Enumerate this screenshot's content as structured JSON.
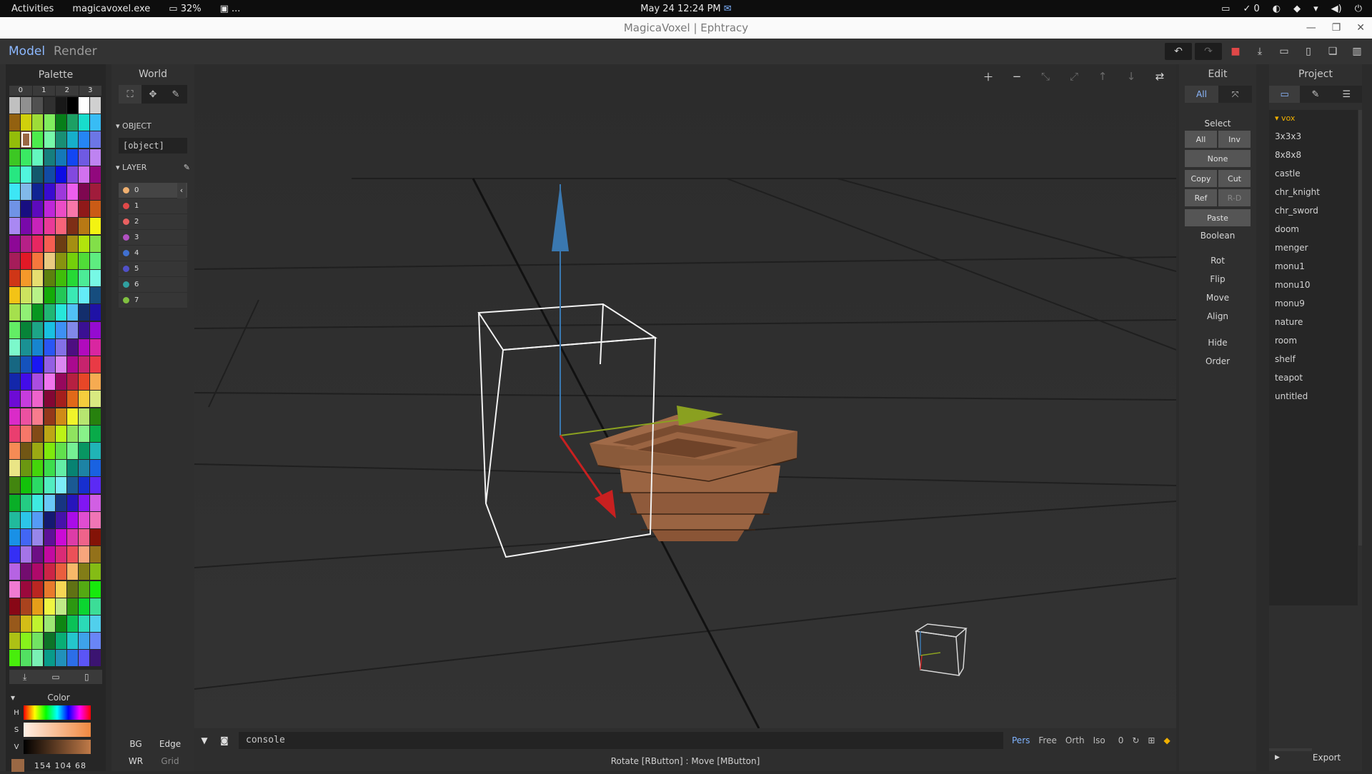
{
  "system": {
    "activities": "Activities",
    "app_name": "magicavoxel.exe",
    "battery": "32%",
    "tray_more": "...",
    "datetime": "May 24  12:24 PM",
    "check_count": "0"
  },
  "window": {
    "title": "MagicaVoxel | Ephtracy"
  },
  "appbar": {
    "mode_model": "Model",
    "mode_render": "Render",
    "project_name": "project"
  },
  "palette": {
    "title": "Palette",
    "tabs": [
      "0",
      "1",
      "2",
      "3"
    ],
    "selected_color": "#9a6844"
  },
  "color": {
    "title": "Color",
    "h": "H",
    "s": "S",
    "v": "V",
    "rgb": "154  104  68"
  },
  "world": {
    "title": "World",
    "object_label": "OBJECT",
    "object_value": "[object]",
    "layer_label": "LAYER",
    "layers": [
      {
        "name": "0",
        "color": "#f0b070"
      },
      {
        "name": "1",
        "color": "#e04848"
      },
      {
        "name": "2",
        "color": "#e86060"
      },
      {
        "name": "3",
        "color": "#b050c0"
      },
      {
        "name": "4",
        "color": "#4070d0"
      },
      {
        "name": "5",
        "color": "#5050c8"
      },
      {
        "name": "6",
        "color": "#30a0a0"
      },
      {
        "name": "7",
        "color": "#80c040"
      }
    ],
    "bg": "BG",
    "edge": "Edge",
    "wr": "WR",
    "grid": "Grid"
  },
  "edit": {
    "title": "Edit",
    "tab_all": "All",
    "select": "Select",
    "all": "All",
    "inv": "Inv",
    "none": "None",
    "copy": "Copy",
    "cut": "Cut",
    "ref": "Ref",
    "rd": "R-D",
    "paste": "Paste",
    "boolean": "Boolean",
    "rot": "Rot",
    "flip": "Flip",
    "move": "Move",
    "align": "Align",
    "hide": "Hide",
    "order": "Order"
  },
  "project": {
    "title": "Project",
    "folder": "vox",
    "files": [
      "3x3x3",
      "8x8x8",
      "castle",
      "chr_knight",
      "chr_sword",
      "doom",
      "menger",
      "monu1",
      "monu10",
      "monu9",
      "nature",
      "room",
      "shelf",
      "teapot",
      "untitled"
    ],
    "export": "Export"
  },
  "viewport": {
    "console_text": "console",
    "views": [
      "Pers",
      "Free",
      "Orth",
      "Iso"
    ],
    "zoom_value": "0",
    "status": "Rotate [RButton] : Move [MButton]"
  }
}
